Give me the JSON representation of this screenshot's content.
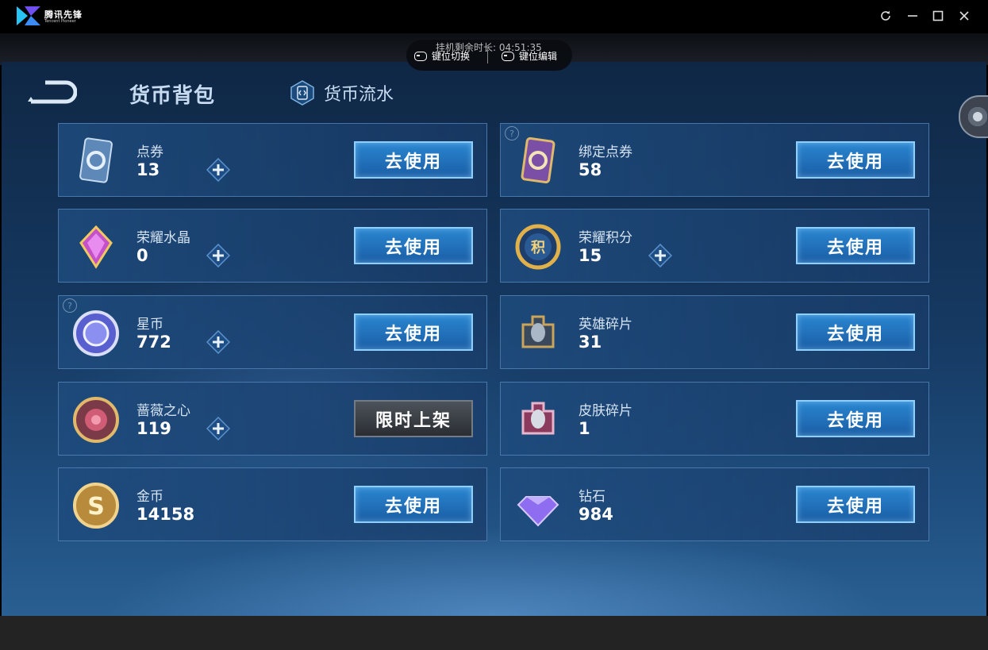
{
  "window": {
    "app_name": "腾讯先锋",
    "app_subtitle": "Tencent Pioneer",
    "refresh_icon": "refresh-icon",
    "minimize_icon": "minimize-icon",
    "maximize_icon": "maximize-icon",
    "close_icon": "close-icon"
  },
  "overlay": {
    "timer_text": "挂机剩余时长: 04:51:35",
    "key_switch_label": "键位切换",
    "key_edit_label": "键位编辑"
  },
  "header": {
    "title": "货币背包",
    "flow_label": "货币流水"
  },
  "buttons": {
    "use_label": "去使用",
    "limited_label": "限时上架"
  },
  "currencies": [
    {
      "name": "点券",
      "count": "13",
      "has_plus": true,
      "has_help": false,
      "button": "use",
      "icon": "coupon-card-icon"
    },
    {
      "name": "绑定点券",
      "count": "58",
      "has_plus": false,
      "has_help": true,
      "button": "use",
      "icon": "bound-coupon-card-icon"
    },
    {
      "name": "荣耀水晶",
      "count": "0",
      "has_plus": true,
      "has_help": false,
      "button": "use",
      "icon": "glory-crystal-icon"
    },
    {
      "name": "荣耀积分",
      "count": "15",
      "has_plus": true,
      "has_help": false,
      "button": "use",
      "icon": "glory-points-icon"
    },
    {
      "name": "星币",
      "count": "772",
      "has_plus": true,
      "has_help": true,
      "button": "use",
      "icon": "star-coin-icon"
    },
    {
      "name": "英雄碎片",
      "count": "31",
      "has_plus": false,
      "has_help": false,
      "button": "use",
      "icon": "hero-fragment-icon"
    },
    {
      "name": "蔷薇之心",
      "count": "119",
      "has_plus": true,
      "has_help": false,
      "button": "limited",
      "icon": "rose-heart-icon"
    },
    {
      "name": "皮肤碎片",
      "count": "1",
      "has_plus": false,
      "has_help": false,
      "button": "use",
      "icon": "skin-fragment-icon"
    },
    {
      "name": "金币",
      "count": "14158",
      "has_plus": false,
      "has_help": false,
      "button": "use",
      "icon": "gold-coin-icon"
    },
    {
      "name": "钻石",
      "count": "984",
      "has_plus": false,
      "has_help": false,
      "button": "use",
      "icon": "diamond-icon"
    }
  ],
  "colors": {
    "use_button": "#1f6fb8",
    "use_border": "#8dd0ff",
    "limited_button": "#3a3f45",
    "background": "#163a63"
  }
}
